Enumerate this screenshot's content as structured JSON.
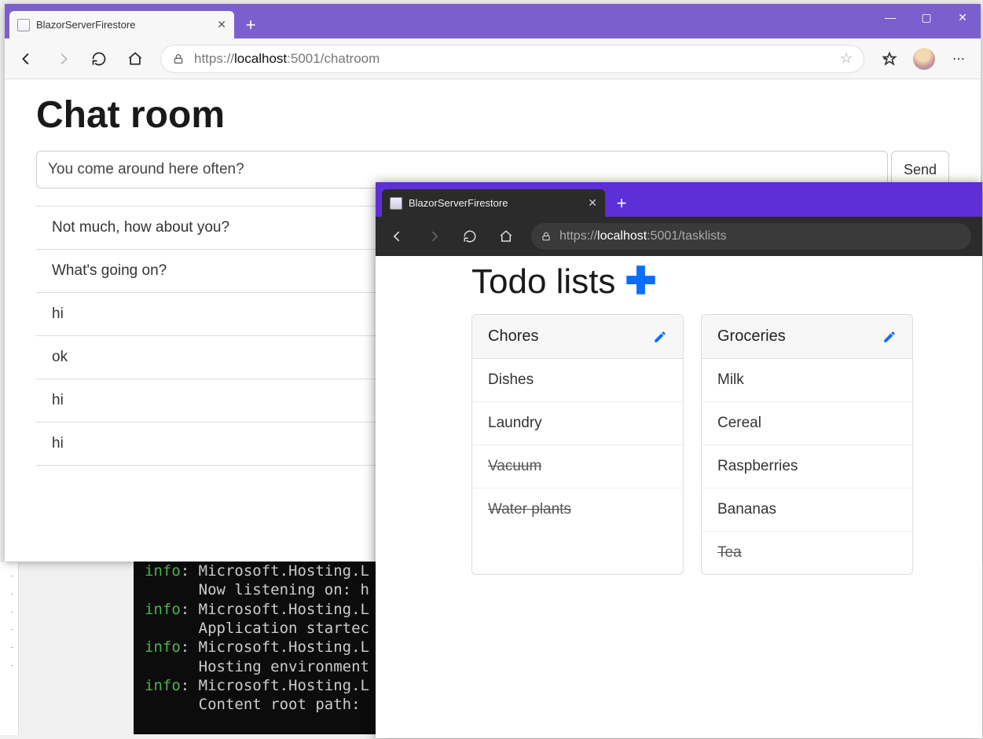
{
  "window1": {
    "tab_title": "BlazorServerFirestore",
    "url_prefix": "https://",
    "url_host_bold": "localhost",
    "url_rest": ":5001/chatroom",
    "page_title": "Chat room",
    "chat_input_value": "You come around here often?",
    "send_label": "Send",
    "messages": [
      "Not much, how about you?",
      "What's going on?",
      "hi",
      "ok",
      "hi",
      "hi"
    ]
  },
  "window2": {
    "tab_title": "BlazorServerFirestore",
    "url_prefix": "https://",
    "url_host_bold": "localhost",
    "url_rest": ":5001/tasklists",
    "page_title": "Todo lists",
    "lists": [
      {
        "name": "Chores",
        "items": [
          {
            "text": "Dishes",
            "done": false
          },
          {
            "text": "Laundry",
            "done": false
          },
          {
            "text": "Vacuum",
            "done": true
          },
          {
            "text": "Water plants",
            "done": true
          }
        ]
      },
      {
        "name": "Groceries",
        "items": [
          {
            "text": "Milk",
            "done": false
          },
          {
            "text": "Cereal",
            "done": false
          },
          {
            "text": "Raspberries",
            "done": false
          },
          {
            "text": "Bananas",
            "done": false
          },
          {
            "text": "Tea",
            "done": true
          }
        ]
      }
    ]
  },
  "terminal": {
    "lines": [
      {
        "prefix": "info",
        "text": ": Microsoft.Hosting.L"
      },
      {
        "prefix": "",
        "text": "      Now listening on: h"
      },
      {
        "prefix": "info",
        "text": ": Microsoft.Hosting.L"
      },
      {
        "prefix": "",
        "text": "      Application startec"
      },
      {
        "prefix": "info",
        "text": ": Microsoft.Hosting.L"
      },
      {
        "prefix": "",
        "text": "      Hosting environment"
      },
      {
        "prefix": "info",
        "text": ": Microsoft.Hosting.L"
      },
      {
        "prefix": "",
        "text": "      Content root path: "
      }
    ]
  }
}
